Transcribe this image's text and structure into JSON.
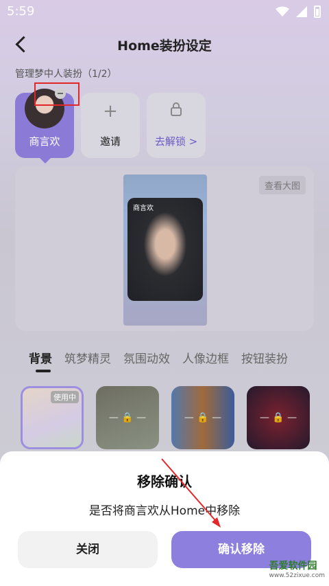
{
  "status": {
    "time": "5:59"
  },
  "header": {
    "title": "Home装扮设定"
  },
  "section": {
    "label": "管理梦中人装扮（1/2）"
  },
  "cards": [
    {
      "label": "商言欢"
    },
    {
      "label": "邀请",
      "icon": "+"
    },
    {
      "label": "去解锁 >"
    }
  ],
  "preview": {
    "view_large": "查看大图",
    "character_name": "商言欢"
  },
  "tabs": [
    "背景",
    "筑梦精灵",
    "氛围动效",
    "人像边框",
    "按钮装扮"
  ],
  "thumbs": {
    "in_use": "使用中"
  },
  "dialog": {
    "title": "移除确认",
    "message": "是否将商言欢从Home中移除",
    "close": "关闭",
    "confirm": "确认移除"
  },
  "watermark": {
    "name": "吾爱软件园",
    "url": "www.52zixue.com"
  },
  "colors": {
    "accent": "#8d7fde",
    "annotation": "#e3262a"
  }
}
